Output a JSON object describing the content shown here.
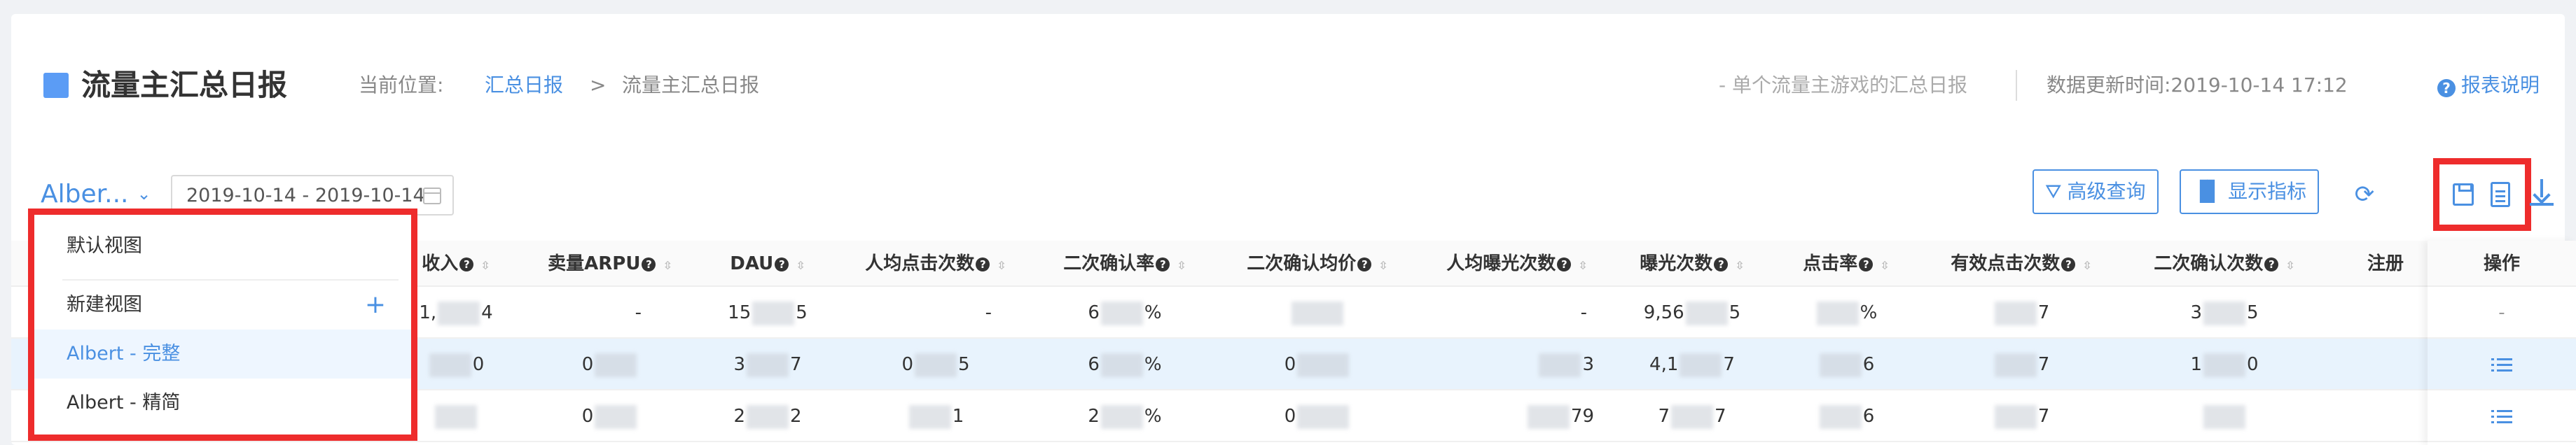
{
  "header": {
    "title": "流量主汇总日报",
    "breadcrumb_label": "当前位置:",
    "breadcrumb_link": "汇总日报",
    "breadcrumb_separator": ">",
    "breadcrumb_current": "流量主汇总日报",
    "description": "- 单个流量主游戏的汇总日报",
    "update_time": "数据更新时间:2019-10-14 17:12",
    "help_label": "报表说明",
    "help_icon_glyph": "?"
  },
  "toolbar": {
    "view_name": "Alber...",
    "view_chevron": "⌄",
    "date_range": "2019-10-14 - 2019-10-14",
    "advanced_query_label": "高级查询",
    "advanced_query_icon": "filter-icon",
    "show_metrics_label": "显示指标",
    "show_metrics_icon": "bar-chart-icon",
    "refresh_icon": "refresh-icon",
    "save_icon": "save-icon",
    "doc_icon": "document-icon",
    "download_icon": "download-icon",
    "accent_color": "#4a90e2",
    "highlight_color": "#ee2c2c"
  },
  "view_dropdown": {
    "items": [
      {
        "label": "默认视图"
      },
      {
        "label": "新建视图",
        "action": "+"
      },
      {
        "label": "Albert - 完整"
      },
      {
        "label": "Albert - 精简"
      }
    ]
  },
  "table": {
    "columns": [
      {
        "label": "收入"
      },
      {
        "label": "卖量ARPU"
      },
      {
        "label": "DAU"
      },
      {
        "label": "人均点击次数"
      },
      {
        "label": "二次确认率"
      },
      {
        "label": "二次确认均价"
      },
      {
        "label": "人均曝光次数"
      },
      {
        "label": "曝光次数"
      },
      {
        "label": "点击率"
      },
      {
        "label": "有效点击次数"
      },
      {
        "label": "二次确认次数"
      },
      {
        "label": "注册"
      }
    ],
    "operation_header": "操作",
    "rows": [
      {
        "income": [
          "1,",
          "4"
        ],
        "arpu": "-",
        "dau": [
          "15",
          "5"
        ],
        "clicks_per_user": "-",
        "confirm_rate": [
          "6",
          "%"
        ],
        "confirm_price": "",
        "exposures_per_user": "-",
        "exposures": [
          "9,56",
          "5"
        ],
        "ctr": "%",
        "valid_clicks": "7",
        "confirm_count": [
          "3",
          "5"
        ],
        "operation": "-"
      },
      {
        "income": [
          "",
          "0"
        ],
        "arpu": "0",
        "dau": [
          "3",
          "7"
        ],
        "clicks_per_user": [
          "0",
          "5"
        ],
        "confirm_rate": [
          "6",
          "%"
        ],
        "confirm_price": "0",
        "exposures_per_user": "3",
        "exposures": [
          "4,1",
          "7"
        ],
        "ctr": "6",
        "valid_clicks": "7",
        "confirm_count": [
          "1",
          "0"
        ],
        "operation": "list-icon"
      },
      {
        "income": [
          "",
          ""
        ],
        "arpu": "0",
        "dau": [
          "2",
          "2"
        ],
        "clicks_per_user": [
          "",
          "1"
        ],
        "confirm_rate": [
          "2",
          "%"
        ],
        "confirm_price": "0",
        "exposures_per_user": "79",
        "exposures": [
          "7",
          "7"
        ],
        "ctr": "6",
        "valid_clicks": "7",
        "confirm_count": [
          "",
          ""
        ],
        "operation": "list-icon"
      }
    ]
  }
}
